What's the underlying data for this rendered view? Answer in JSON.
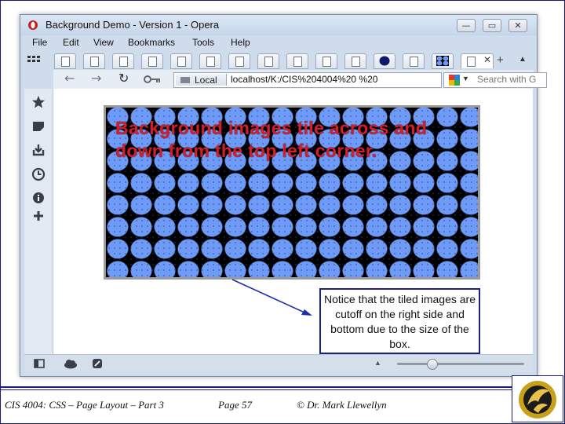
{
  "window": {
    "title": "Background Demo - Version 1 - Opera"
  },
  "window_controls": {
    "minimize": "—",
    "maximize": "▭",
    "close": "✕"
  },
  "menu": [
    "File",
    "Edit",
    "View",
    "Bookmarks",
    "Tools",
    "Help"
  ],
  "tabs": {
    "close_glyph": "✕",
    "add_glyph": "+"
  },
  "toolbar": {
    "back": "←",
    "forward": "→",
    "reload": "↻",
    "security_label": "Local",
    "url": "localhost/K:/CIS%204004%20 %20",
    "search_placeholder": "Search with G"
  },
  "page": {
    "demo_text": "Background images tile across and down from the top left corner.",
    "note": "Notice that the tiled images are cutoff on the right side and bottom due to the size of the box."
  },
  "statusbar": {
    "zoom_fraction": 0.28
  },
  "footer": {
    "course": "CIS 4004: CSS – Page Layout – Part 3",
    "page": "Page 57",
    "author": "© Dr. Mark Llewellyn"
  },
  "colors": {
    "tile_fill": "#6e9bf8",
    "demo_text": "#d41f2b",
    "note_border": "#1f1f80",
    "arrow": "#1f2fa8"
  },
  "icons": {
    "sidebar": [
      "star-icon",
      "notes-icon",
      "downloads-icon",
      "history-icon",
      "info-icon",
      "add-panel-icon"
    ],
    "statusbar": [
      "panel-toggle-icon",
      "cloud-icon",
      "speed-dial-icon"
    ]
  }
}
